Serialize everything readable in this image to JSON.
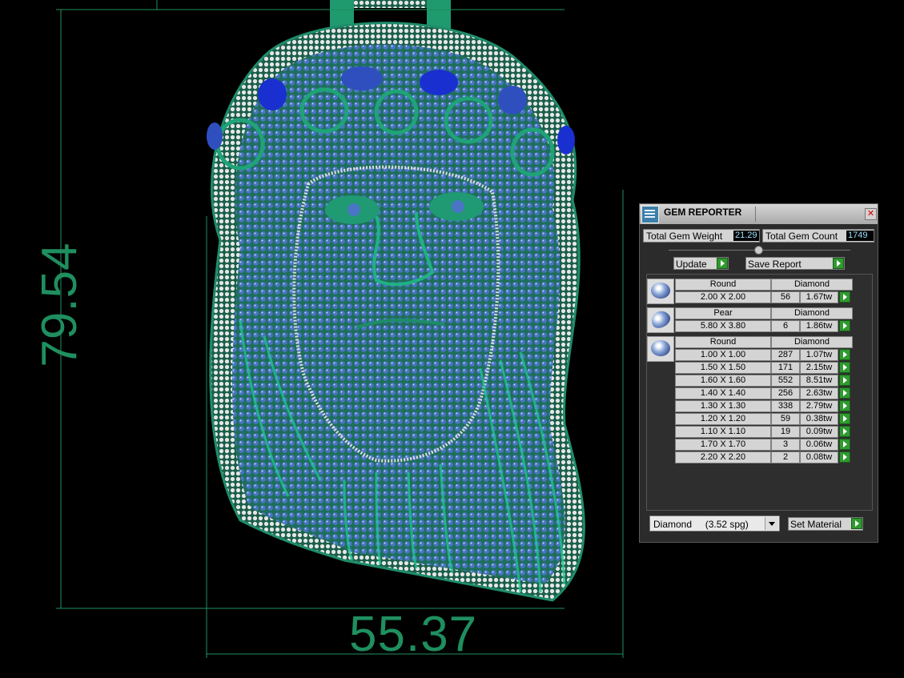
{
  "dimensions": {
    "width_label": "55.37",
    "height_label": "79.54"
  },
  "colors": {
    "dimension_line": "#1f8f5f",
    "metal": "#1e8c6a",
    "gem_blue": "#3d64b8",
    "diamond": "#e8e8e8",
    "sapphire": "#1a2fd0"
  },
  "panel": {
    "title": "GEM REPORTER",
    "close_icon": "close-icon",
    "total_weight_label": "Total Gem Weight",
    "total_weight_value": "21.29",
    "total_count_label": "Total Gem Count",
    "total_count_value": "1749",
    "update_label": "Update",
    "save_report_label": "Save Report",
    "groups": [
      {
        "shape": "Round",
        "material": "Diamond",
        "icon": "round-gem-icon",
        "rows": [
          {
            "size": "2.00 X 2.00",
            "count": "56",
            "weight": "1.67tw"
          }
        ]
      },
      {
        "shape": "Pear",
        "material": "Diamond",
        "icon": "pear-gem-icon",
        "rows": [
          {
            "size": "5.80 X 3.80",
            "count": "6",
            "weight": "1.86tw"
          }
        ]
      },
      {
        "shape": "Round",
        "material": "Diamond",
        "icon": "round-gem-icon",
        "rows": [
          {
            "size": "1.00 X 1.00",
            "count": "287",
            "weight": "1.07tw"
          },
          {
            "size": "1.50 X 1.50",
            "count": "171",
            "weight": "2.15tw"
          },
          {
            "size": "1.60 X 1.60",
            "count": "552",
            "weight": "8.51tw"
          },
          {
            "size": "1.40 X 1.40",
            "count": "256",
            "weight": "2.63tw"
          },
          {
            "size": "1.30 X 1.30",
            "count": "338",
            "weight": "2.79tw"
          },
          {
            "size": "1.20 X 1.20",
            "count": "59",
            "weight": "0.38tw"
          },
          {
            "size": "1.10 X 1.10",
            "count": "19",
            "weight": "0.09tw"
          },
          {
            "size": "1.70 X 1.70",
            "count": "3",
            "weight": "0.06tw"
          },
          {
            "size": "2.20 X 2.20",
            "count": "2",
            "weight": "0.08tw"
          }
        ]
      }
    ],
    "material_select": "Diamond     (3.52 spg)",
    "set_material_label": "Set Material"
  }
}
